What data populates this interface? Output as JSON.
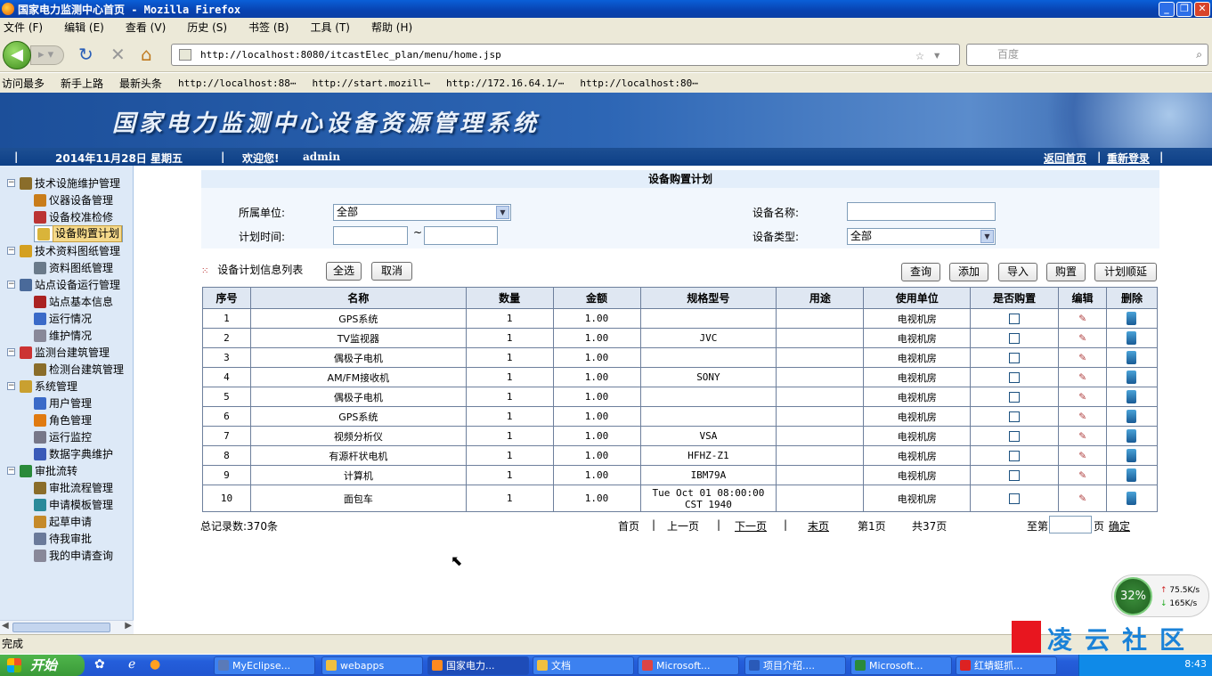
{
  "window": {
    "title": "国家电力监测中心首页 - Mozilla Firefox"
  },
  "menu": [
    "文件 (F)",
    "编辑 (E)",
    "查看 (V)",
    "历史 (S)",
    "书签 (B)",
    "工具 (T)",
    "帮助 (H)"
  ],
  "nav": {
    "url": "http://localhost:8080/itcastElec_plan/menu/home.jsp",
    "search_placeholder": "百度"
  },
  "bookmarks": [
    "访问最多",
    "新手上路",
    "最新头条",
    "http://localhost:88⋯",
    "http://start.mozill⋯",
    "http://172.16.64.1/⋯",
    "http://localhost:80⋯"
  ],
  "banner": {
    "title": "国家电力监测中心设备资源管理系统"
  },
  "infobar": {
    "date": "2014年11月28日 星期五",
    "welcome": "欢迎您!",
    "user": "admin",
    "home_link": "返回首页",
    "relogin_link": "重新登录"
  },
  "sidebar": {
    "items": [
      {
        "label": "技术设施维护管理",
        "level": 0,
        "icon_color": "#8a6d2a"
      },
      {
        "label": "仪器设备管理",
        "level": 1,
        "icon_color": "#c97d1a"
      },
      {
        "label": "设备校准检修",
        "level": 1,
        "icon_color": "#b33"
      },
      {
        "label": "设备购置计划",
        "level": 1,
        "icon_color": "#d9b43a",
        "selected": true
      },
      {
        "label": "技术资料图纸管理",
        "level": 0,
        "icon_color": "#d4a020"
      },
      {
        "label": "资料图纸管理",
        "level": 1,
        "icon_color": "#6a7a8a"
      },
      {
        "label": "站点设备运行管理",
        "level": 0,
        "icon_color": "#4a6a9a"
      },
      {
        "label": "站点基本信息",
        "level": 1,
        "icon_color": "#a22"
      },
      {
        "label": "运行情况",
        "level": 1,
        "icon_color": "#3a6ac8"
      },
      {
        "label": "维护情况",
        "level": 1,
        "icon_color": "#889"
      },
      {
        "label": "监测台建筑管理",
        "level": 0,
        "icon_color": "#c33"
      },
      {
        "label": "检测台建筑管理",
        "level": 1,
        "icon_color": "#8a6d2a"
      },
      {
        "label": "系统管理",
        "level": 0,
        "icon_color": "#c9a030"
      },
      {
        "label": "用户管理",
        "level": 1,
        "icon_color": "#3a6ac8"
      },
      {
        "label": "角色管理",
        "level": 1,
        "icon_color": "#e07a10"
      },
      {
        "label": "运行监控",
        "level": 1,
        "icon_color": "#778"
      },
      {
        "label": "数据字典维护",
        "level": 1,
        "icon_color": "#3a5ab8"
      },
      {
        "label": "审批流转",
        "level": 0,
        "icon_color": "#2a8a3a"
      },
      {
        "label": "审批流程管理",
        "level": 1,
        "icon_color": "#8a6d2a"
      },
      {
        "label": "申请模板管理",
        "level": 1,
        "icon_color": "#2a8a9a"
      },
      {
        "label": "起草申请",
        "level": 1,
        "icon_color": "#c58a2a"
      },
      {
        "label": "待我审批",
        "level": 1,
        "icon_color": "#6a7a9a"
      },
      {
        "label": "我的申请查询",
        "level": 1,
        "icon_color": "#889"
      }
    ]
  },
  "page": {
    "title": "设备购置计划",
    "filters": {
      "unit_label": "所属单位:",
      "unit_value": "全部",
      "time_label": "计划时间:",
      "time_sep": "~",
      "name_label": "设备名称:",
      "type_label": "设备类型:",
      "type_value": "全部"
    },
    "list_title": "设备计划信息列表",
    "buttons": {
      "select_all": "全选",
      "cancel": "取消",
      "query": "查询",
      "add": "添加",
      "import": "导入",
      "purchase": "购置",
      "postpone": "计划顺延"
    },
    "table": {
      "headers": [
        "序号",
        "名称",
        "数量",
        "金额",
        "规格型号",
        "用途",
        "使用单位",
        "是否购置",
        "编辑",
        "删除"
      ],
      "rows": [
        [
          "1",
          "GPS系统",
          "1",
          "1.00",
          "",
          "",
          "电视机房"
        ],
        [
          "2",
          "TV监视器",
          "1",
          "1.00",
          "JVC",
          "",
          "电视机房"
        ],
        [
          "3",
          "偶极子电机",
          "1",
          "1.00",
          "",
          "",
          "电视机房"
        ],
        [
          "4",
          "AM/FM接收机",
          "1",
          "1.00",
          "SONY",
          "",
          "电视机房"
        ],
        [
          "5",
          "偶极子电机",
          "1",
          "1.00",
          "",
          "",
          "电视机房"
        ],
        [
          "6",
          "GPS系统",
          "1",
          "1.00",
          "",
          "",
          "电视机房"
        ],
        [
          "7",
          "视频分析仪",
          "1",
          "1.00",
          "VSA",
          "",
          "电视机房"
        ],
        [
          "8",
          "有源杆状电机",
          "1",
          "1.00",
          "HFHZ-Z1",
          "",
          "电视机房"
        ],
        [
          "9",
          "计算机",
          "1",
          "1.00",
          "IBM79A",
          "",
          "电视机房"
        ],
        [
          "10",
          "面包车",
          "1",
          "1.00",
          "Tue Oct 01 08:00:00 CST 1940",
          "",
          "电视机房"
        ]
      ]
    },
    "pager": {
      "total": "总记录数:370条",
      "first": "首页",
      "sep": "|",
      "prev": "上一页",
      "next": "下一页",
      "last": "末页",
      "current": "第1页",
      "pages": "共37页",
      "goto_prefix": "至第",
      "goto_suffix": "页",
      "confirm": "确定"
    }
  },
  "net_widget": {
    "percent": "32%",
    "up": "75.5K/s",
    "down": "165K/s"
  },
  "status": {
    "text": "完成"
  },
  "watermark": {
    "text": "凌云社区"
  },
  "taskbar": {
    "start": "开始",
    "tasks": [
      "MyEclipse...",
      "webapps",
      "国家电力...",
      "文档",
      "Microsoft...",
      "项目介绍....",
      "Microsoft...",
      "红蜻蜓抓..."
    ],
    "clock": "8:43"
  }
}
